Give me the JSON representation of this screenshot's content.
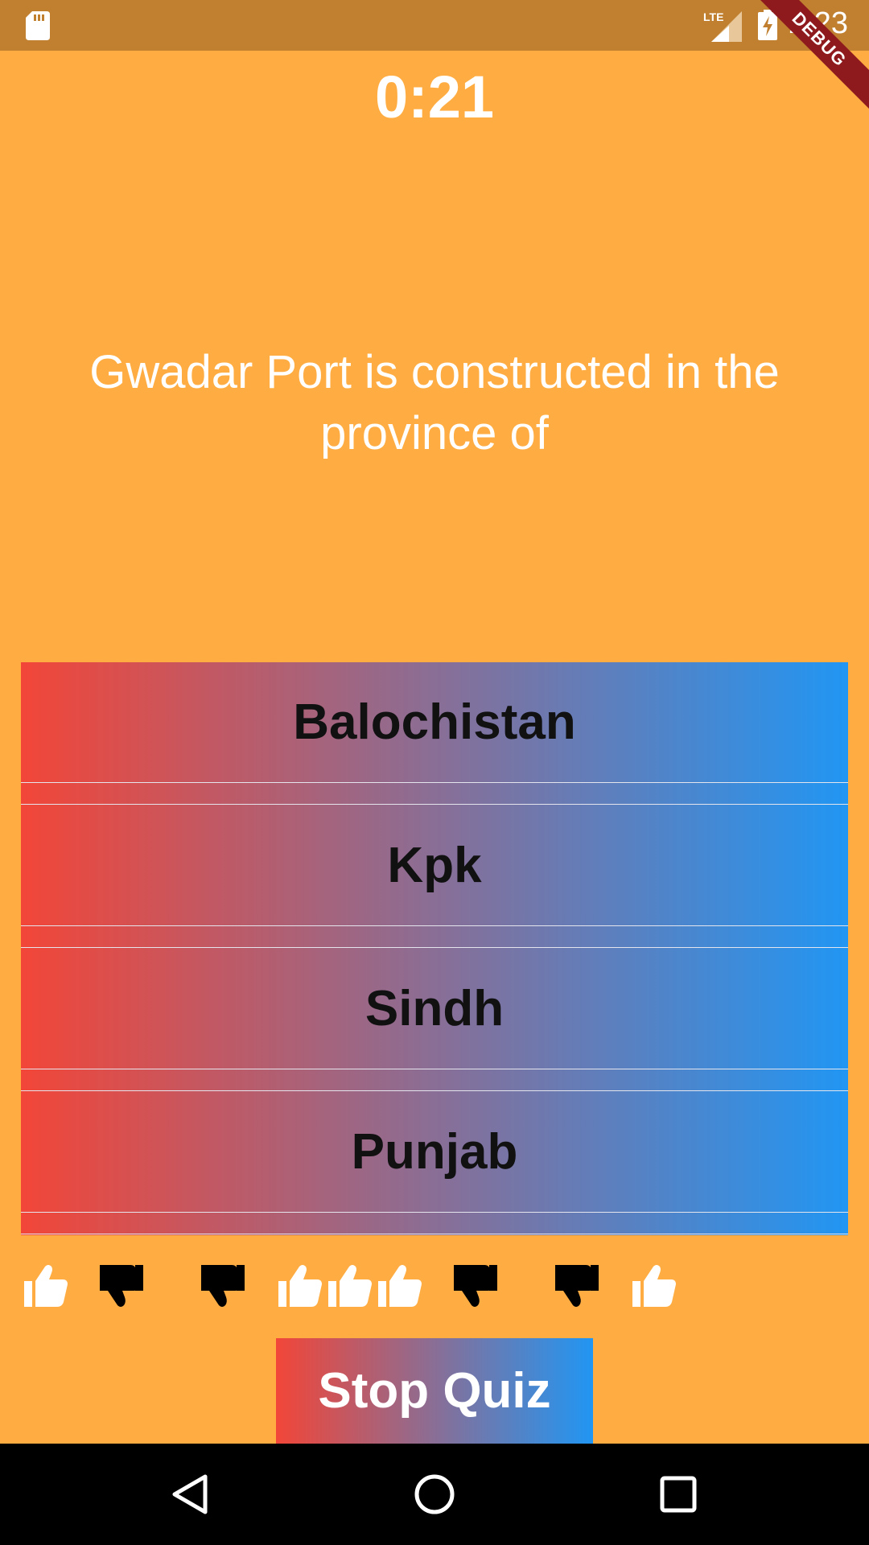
{
  "status_bar": {
    "time": "2:23",
    "network": "LTE",
    "debug_banner": "DEBUG",
    "icons": [
      "sd-card-icon",
      "lte-signal-icon",
      "battery-charging-icon"
    ]
  },
  "quiz": {
    "timer": "0:21",
    "question": "Gwadar Port is constructed in the province of",
    "answers": [
      {
        "label": "Balochistan"
      },
      {
        "label": "Kpk"
      },
      {
        "label": "Sindh"
      },
      {
        "label": "Punjab"
      }
    ],
    "score_keeper": [
      "correct",
      "wrong",
      "wrong",
      "correct",
      "correct",
      "correct",
      "wrong",
      "wrong",
      "correct"
    ],
    "stop_button_label": "Stop Quiz"
  },
  "colors": {
    "background": "#FFAD42",
    "gradient_start": "#F24638",
    "gradient_end": "#2196F3",
    "correct_icon": "#FFFFFF",
    "wrong_icon": "#000000"
  },
  "nav_bar": {
    "buttons": [
      "back-icon",
      "home-icon",
      "recents-icon"
    ]
  }
}
